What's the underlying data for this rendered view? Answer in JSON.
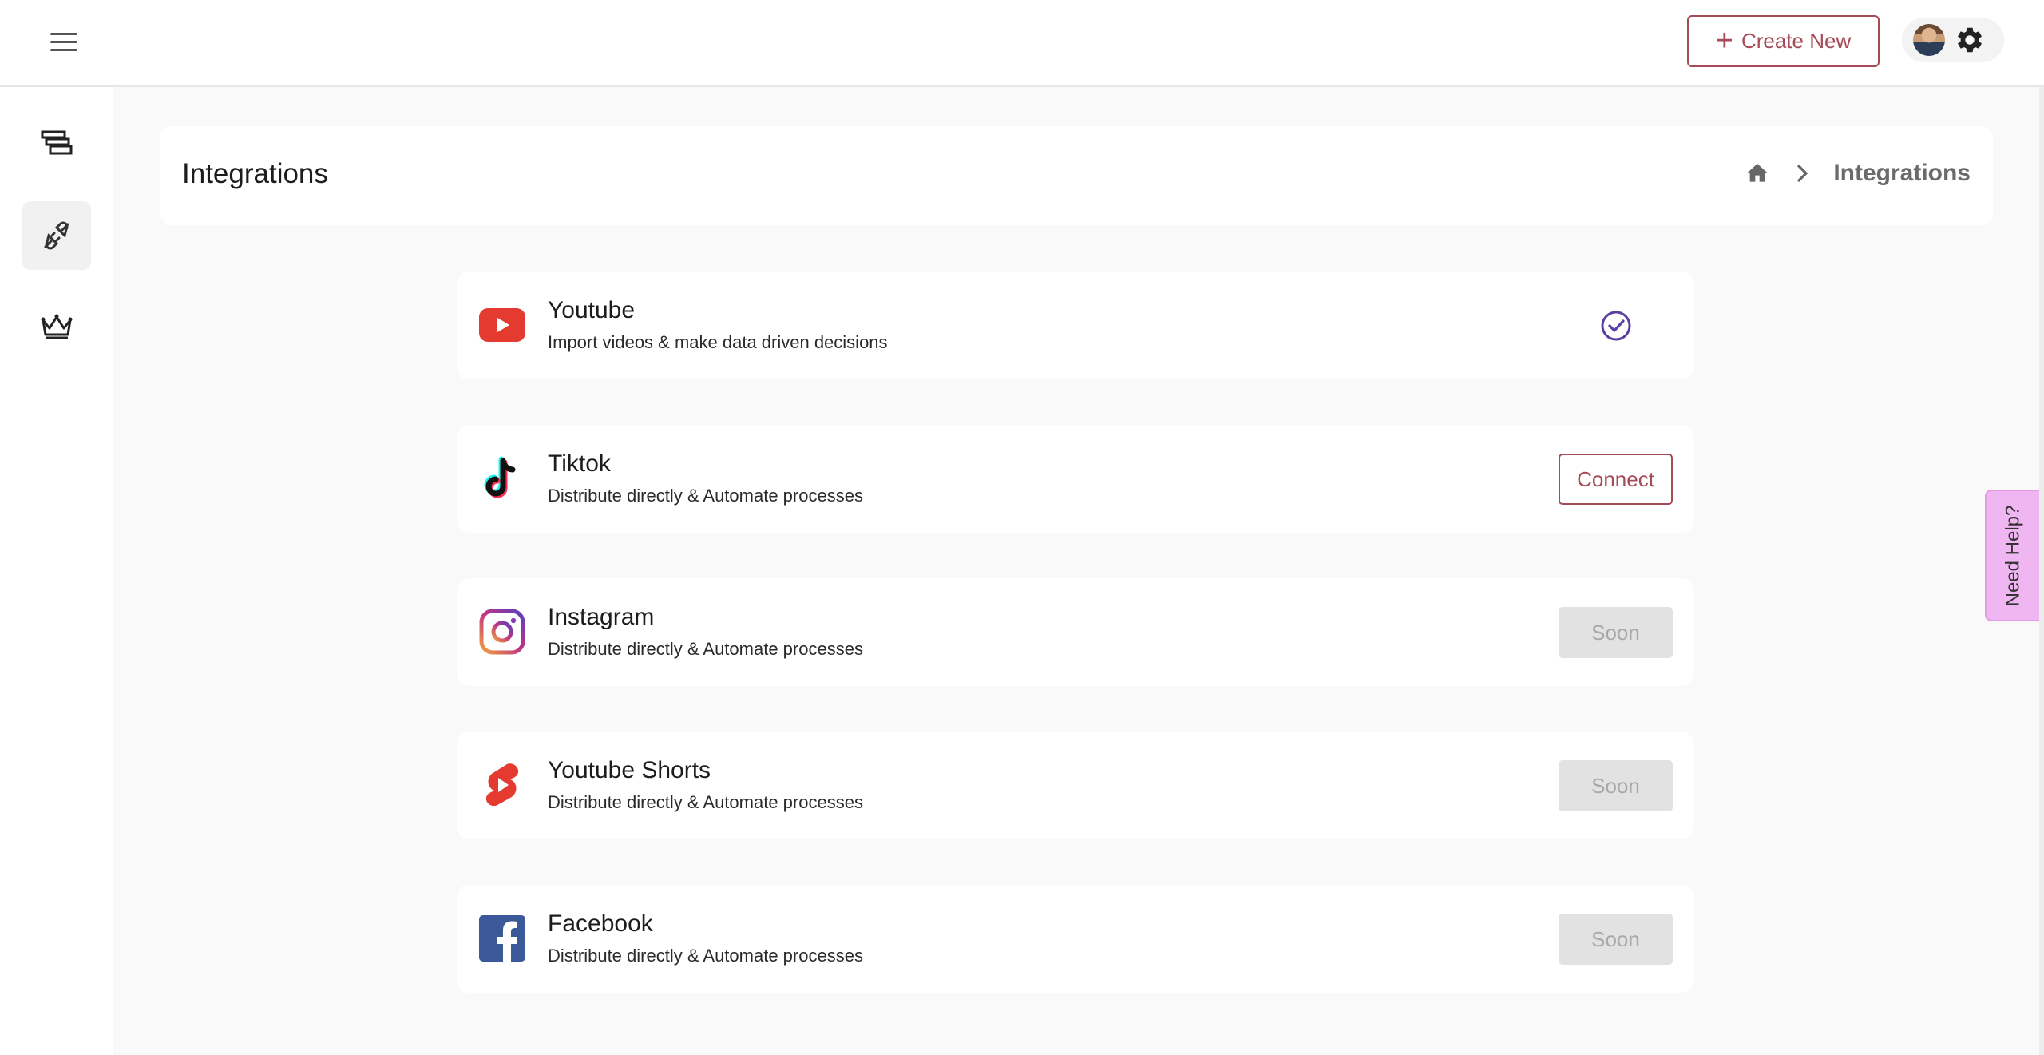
{
  "topbar": {
    "menu_icon": "hamburger-menu-icon",
    "create_button": {
      "label": "Create New",
      "icon": "plus-icon"
    },
    "profile": {
      "avatar_icon": "user-avatar",
      "settings_icon": "gear-icon"
    }
  },
  "sidebar": {
    "items": [
      {
        "name": "content-library",
        "icon": "stacked-cards-icon",
        "active": false
      },
      {
        "name": "integrations",
        "icon": "plug-connector-icon",
        "active": true
      },
      {
        "name": "premium",
        "icon": "crown-icon",
        "active": false
      }
    ]
  },
  "header": {
    "title": "Integrations",
    "breadcrumb": {
      "home_icon": "home-icon",
      "separator_icon": "chevron-right-icon",
      "current": "Integrations"
    }
  },
  "integrations": [
    {
      "name": "Youtube",
      "description": "Import videos & make data driven decisions",
      "status": "connected",
      "logo": "youtube-logo-icon"
    },
    {
      "name": "Tiktok",
      "description": "Distribute directly & Automate processes",
      "status": "connect",
      "action_label": "Connect",
      "logo": "tiktok-logo-icon"
    },
    {
      "name": "Instagram",
      "description": "Distribute directly & Automate processes",
      "status": "soon",
      "action_label": "Soon",
      "logo": "instagram-logo-icon"
    },
    {
      "name": "Youtube Shorts",
      "description": "Distribute directly & Automate processes",
      "status": "soon",
      "action_label": "Soon",
      "logo": "youtube-shorts-logo-icon"
    },
    {
      "name": "Facebook",
      "description": "Distribute directly & Automate processes",
      "status": "soon",
      "action_label": "Soon",
      "logo": "facebook-logo-icon"
    }
  ],
  "help_tab": {
    "label": "Need Help?"
  },
  "colors": {
    "accent": "#a54b57",
    "check": "#5a3fa0",
    "help_tab": "#f0b6f2",
    "soon_bg": "#e2e2e2",
    "youtube_red": "#e53a2f",
    "facebook_blue": "#3b5998"
  }
}
